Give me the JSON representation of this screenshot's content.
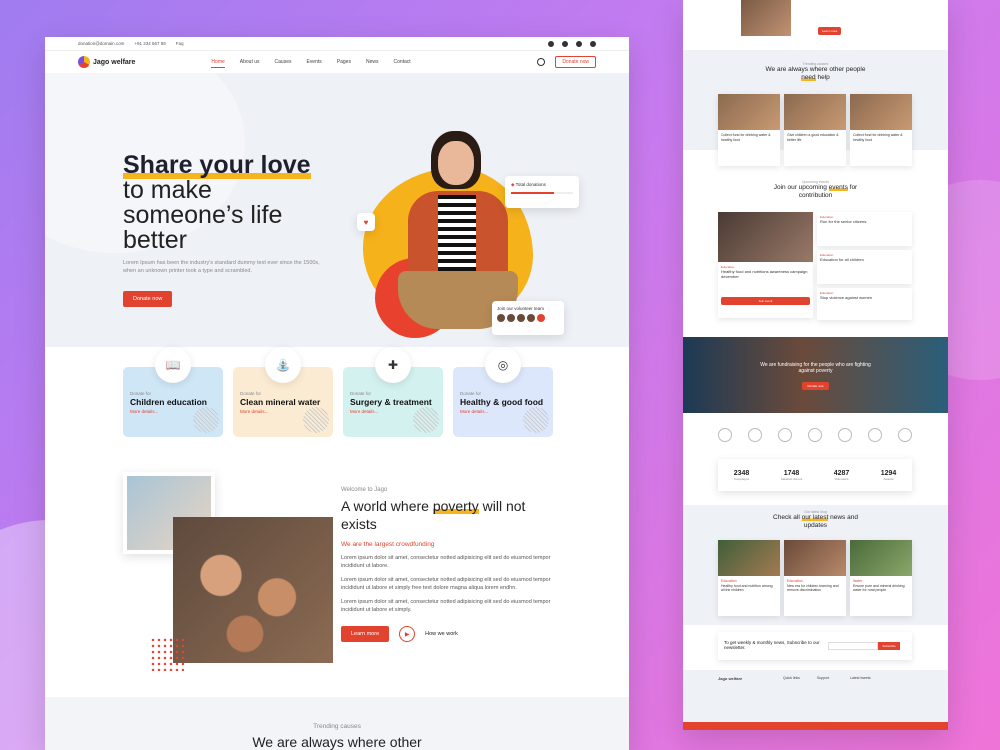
{
  "topbar": {
    "email": "donation@domain.com",
    "phone": "+91 234 567 89",
    "faq": "Faq"
  },
  "nav": {
    "logo": "Jago welfare",
    "items": [
      "Home",
      "About us",
      "Causes",
      "Events",
      "Pages",
      "News",
      "Contact"
    ],
    "cta": "Donate now"
  },
  "hero": {
    "title_bold": "Share your love",
    "title_rest": "to make someone’s life better",
    "text": "Lorem Ipsum has been the industry's standard dummy text ever since the 1500s, when an unknown printer took a type and scrambled.",
    "button": "Donate now",
    "donations_label": "Total donations",
    "volunteer_label": "Join our volunteer team"
  },
  "causes": [
    {
      "pre": "Donate for",
      "title": "Children education",
      "link": "More details...",
      "color": "#cfe6f7"
    },
    {
      "pre": "Donate for",
      "title": "Clean mineral water",
      "link": "More details...",
      "color": "#fcebd3"
    },
    {
      "pre": "Donate for",
      "title": "Surgery & treatment",
      "link": "More details...",
      "color": "#d3f1ef"
    },
    {
      "pre": "Donate for",
      "title": "Healthy & good food",
      "link": "More details...",
      "color": "#dde7fb"
    }
  ],
  "about": {
    "pre": "Welcome to Jago",
    "title_a": "A world where ",
    "title_hl": "poverty",
    "title_b": " will not exists",
    "subtitle": "We are the largest crowdfunding",
    "p1": "Lorem ipsum dolor sit amet, consectetur notted adipisicing elit sed do eiusmod tempor incididunt ut labore.",
    "p2": "Lorem ipsum dolor sit amet, consectetur notted adipisicing elit sed do eiusmod tempor incididunt ut labore et simply free text dolore magna aliqua lorem endhn.",
    "p3": "Lorem ipsum dolor sit amet, consectetur notted adipisicing elit sed do eiusmod tempor incididunt ut labore et simply.",
    "learn": "Learn more",
    "how": "How we work"
  },
  "trending": {
    "pre": "Trending causes",
    "title": "We are always where other"
  },
  "right": {
    "trending_pre": "Trending causes",
    "trending_title_a": "We are always where other people ",
    "trending_title_hl": "need",
    "trending_title_b": " help",
    "cards": [
      "Collect fund for drinking water & healthy food",
      "Give children a good education & better life",
      "Collect fund for drinking water & healthy food"
    ],
    "events_pre": "Upcoming events",
    "events_title_a": "Join our upcoming ",
    "events_title_hl": "events",
    "events_title_b": " for contribution",
    "events": [
      "Run for the senior citizens.",
      "Healthy food and nutritions awareness campaign december",
      "Education for all children",
      "Stop violence against women"
    ],
    "join": "Join event",
    "banner_text": "We are fundraising for the people who are fighting against poverty",
    "banner_btn": "Donate now",
    "stats": [
      {
        "n": "2348",
        "l": "Campaigns"
      },
      {
        "n": "1748",
        "l": "Satisfied donors"
      },
      {
        "n": "4287",
        "l": "Volunteers"
      },
      {
        "n": "1294",
        "l": "Awards"
      }
    ],
    "news_pre": "Our latest blog",
    "news_title_a": "Check all ",
    "news_title_hl": "our latest",
    "news_title_b": " news and updates",
    "news": [
      {
        "tag": "Education",
        "t": "Healthy food and nutrition among all the children"
      },
      {
        "tag": "Education",
        "t": "New era for children learning and remove discrimination"
      },
      {
        "tag": "Water",
        "t": "Ensure pure and mineral drinking water for rural people"
      }
    ],
    "newsletter": "To get weekly & monthly news, Subscribe to our newsletter.",
    "subscribe": "Subscribe",
    "footer_cols": [
      "Quick links",
      "Support",
      "Latest tweets"
    ]
  }
}
